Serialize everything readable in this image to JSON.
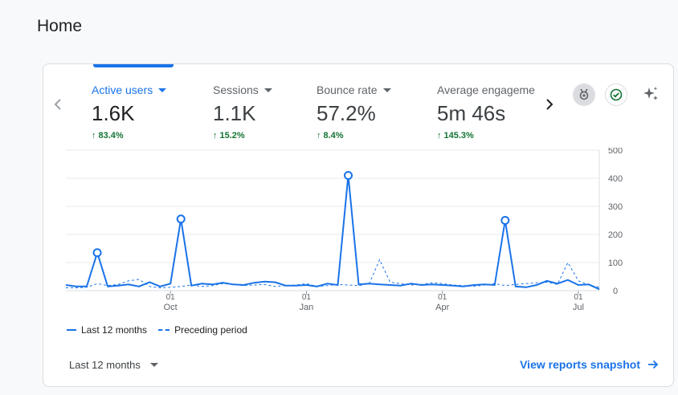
{
  "page": {
    "title": "Home"
  },
  "metrics": [
    {
      "label": "Active users",
      "value": "1.6K",
      "delta": "83.4%",
      "active": true
    },
    {
      "label": "Sessions",
      "value": "1.1K",
      "delta": "15.2%",
      "active": false
    },
    {
      "label": "Bounce rate",
      "value": "57.2%",
      "delta": "8.4%",
      "active": false
    },
    {
      "label": "Average engagement time",
      "value": "5m 46s",
      "delta": "145.3%",
      "active": false
    }
  ],
  "chart_data": {
    "type": "line",
    "x_ticks": [
      {
        "index": 10,
        "day": "01",
        "month": "Oct"
      },
      {
        "index": 23,
        "day": "01",
        "month": "Jan"
      },
      {
        "index": 36,
        "day": "01",
        "month": "Apr"
      },
      {
        "index": 49,
        "day": "01",
        "month": "Jul"
      }
    ],
    "y_ticks": [
      0,
      100,
      200,
      300,
      400,
      500
    ],
    "ylim": [
      0,
      500
    ],
    "axis_position": "right",
    "series": [
      {
        "name": "Last 12 months",
        "style": "solid",
        "values": [
          20,
          15,
          15,
          135,
          15,
          18,
          22,
          15,
          30,
          15,
          25,
          255,
          18,
          25,
          22,
          28,
          22,
          20,
          28,
          32,
          30,
          18,
          18,
          20,
          15,
          25,
          20,
          410,
          22,
          25,
          22,
          20,
          18,
          25,
          20,
          22,
          20,
          18,
          15,
          20,
          22,
          20,
          250,
          15,
          12,
          20,
          35,
          25,
          38,
          20,
          22,
          5
        ],
        "markers": [
          3,
          11,
          27,
          42
        ]
      },
      {
        "name": "Preceding period",
        "style": "dashed",
        "values": [
          10,
          10,
          12,
          25,
          18,
          22,
          35,
          40,
          15,
          10,
          12,
          15,
          20,
          15,
          18,
          25,
          22,
          18,
          20,
          22,
          15,
          18,
          20,
          25,
          15,
          18,
          22,
          20,
          18,
          25,
          110,
          30,
          25,
          20,
          22,
          28,
          25,
          20,
          18,
          15,
          20,
          25,
          18,
          22,
          25,
          28,
          30,
          22,
          100,
          35,
          20,
          12
        ]
      }
    ]
  },
  "legend": {
    "current_label": "Last 12 months",
    "previous_label": "Preceding period"
  },
  "footer": {
    "date_range": "Last 12 months",
    "view_link": "View reports snapshot"
  },
  "colors": {
    "accent": "#1a73e8",
    "positive": "#137333",
    "grid": "#e8eaed"
  },
  "icons": {
    "prev": "chevron-left-icon",
    "next": "chevron-right-icon",
    "insights": "sparkle-icon",
    "status": "check-circle-icon",
    "badge": "award-badge-icon"
  }
}
